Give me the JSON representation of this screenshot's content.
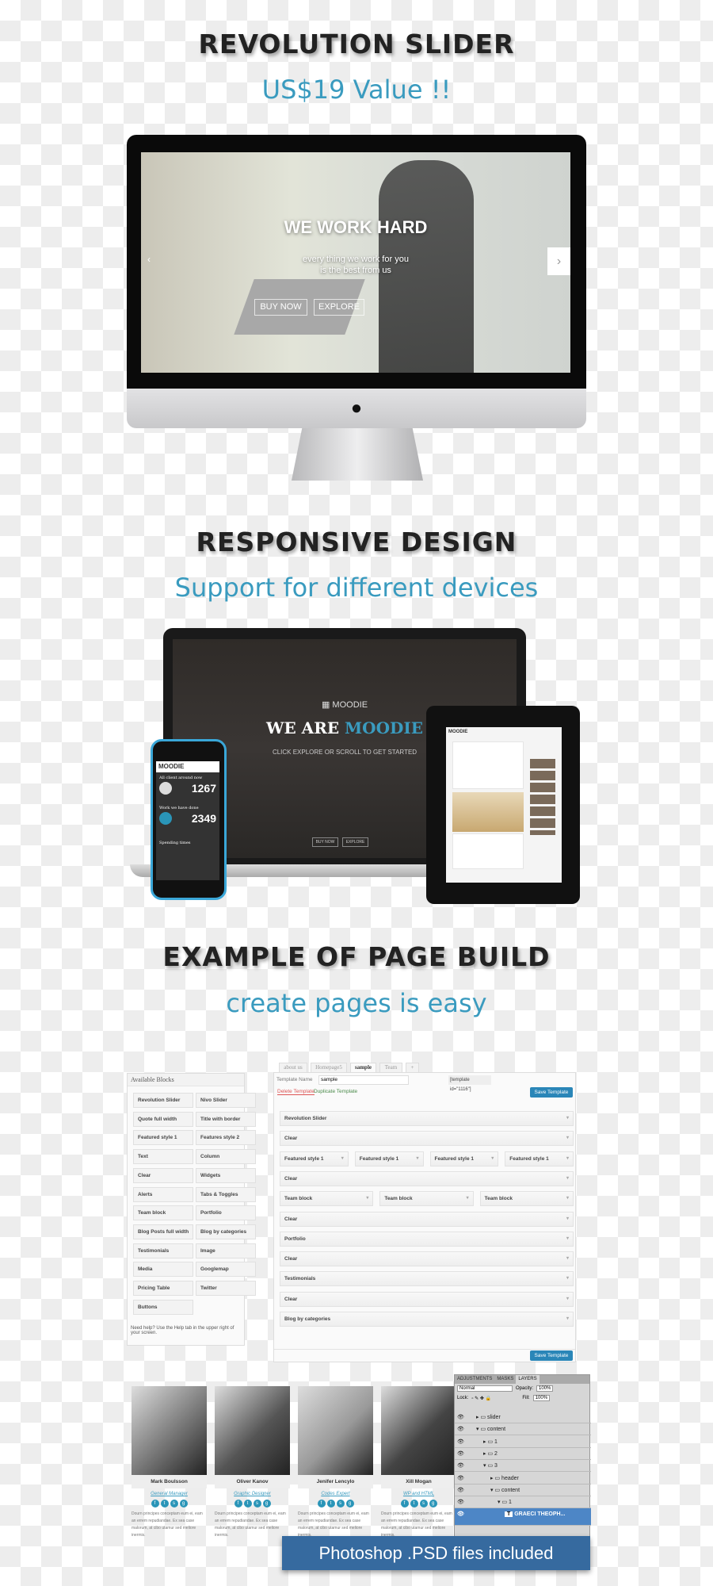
{
  "sections": {
    "revolution": {
      "title": "REVOLUTION SLIDER",
      "subtitle": "US$19 Value !!"
    },
    "responsive": {
      "title": "RESPONSIVE DESIGN",
      "subtitle": "Support for different devices"
    },
    "page_build": {
      "title": "EXAMPLE OF PAGE BUILD",
      "subtitle": "create pages is easy"
    }
  },
  "slider": {
    "title": "WE WORK HARD",
    "line1": "every thing we work for you",
    "line2": "is the best from us",
    "buy": "BUY NOW",
    "explore": "EXPLORE"
  },
  "laptop": {
    "logo": "MOODIE",
    "title_a": "WE ARE ",
    "title_b": "MOODIE",
    "sub": "CLICK EXPLORE OR SCROLL TO GET STARTED",
    "buy": "BUY NOW",
    "explore": "EXPLORE"
  },
  "phone": {
    "logo": "MOODIE",
    "stat1_label": "All client around now",
    "stat1": "1267",
    "stat2_label": "Work we have done",
    "stat2": "2349",
    "stat3_label": "Spending times"
  },
  "tablet": {
    "logo": "MOODIE"
  },
  "builder": {
    "tabs": [
      "about us",
      "Homepage5",
      "sample",
      "Team",
      "+"
    ],
    "available_title": "Available Blocks",
    "blocks": [
      "Revolution Slider",
      "Nivo Slider",
      "Quote full width",
      "Title with border",
      "Featured style 1",
      "Features style 2",
      "Text",
      "Column",
      "Clear",
      "Widgets",
      "Alerts",
      "Tabs & Toggles",
      "Team block",
      "Portfolio",
      "Blog Posts full width",
      "Blog by categories",
      "Testimonials",
      "Image",
      "Media",
      "Googlemap",
      "Pricing Table",
      "Twitter",
      "Buttons"
    ],
    "help": "Need help? Use the Help tab in the upper right of your screen.",
    "template_name_label": "Template Name",
    "template_name_value": "sample",
    "shortcode": "[template id=\"1116\"]",
    "delete": "Delete Template",
    "duplicate": "Duplicate Template",
    "save": "Save Template",
    "rows": [
      [
        "Revolution Slider"
      ],
      [
        "Clear"
      ],
      [
        "Featured style 1",
        "Featured style 1",
        "Featured style 1",
        "Featured style 1"
      ],
      [
        "Clear"
      ],
      [
        "Team block",
        "Team block",
        "Team block"
      ],
      [
        "Clear"
      ],
      [
        "Portfolio"
      ],
      [
        "Clear"
      ],
      [
        "Testimonials"
      ],
      [
        "Clear"
      ],
      [
        "Blog by categories"
      ]
    ]
  },
  "team": [
    {
      "name": "Mark Boulsson",
      "role": "General Manager"
    },
    {
      "name": "Oliver Kanov",
      "role": "Graphic Designer"
    },
    {
      "name": "Jenifer Lencylo",
      "role": "Codes Expert"
    },
    {
      "name": "Xill Mogan",
      "role": "WP and HTML"
    }
  ],
  "team_text": "Dourn principes conceptam eum ei, eam an errem repudiandae. Ex sea case malorum, at cibo utamur sed meliore inermis.",
  "layers": {
    "tabs": [
      "ADJUSTMENTS",
      "MASKS",
      "LAYERS"
    ],
    "blend": "Normal",
    "opacity_label": "Opacity:",
    "opacity": "100%",
    "lock_label": "Lock:",
    "fill_label": "Fill:",
    "fill": "100%",
    "items": [
      "slider",
      "content",
      "1",
      "2",
      "3",
      "header",
      "content",
      "1",
      "GRAECI THEOPH..."
    ]
  },
  "psd_banner": "Photoshop .PSD files included",
  "colors": {
    "accent": "#3a9bbf",
    "save_button": "#2a86b8",
    "psd_banner": "#366a9f"
  }
}
